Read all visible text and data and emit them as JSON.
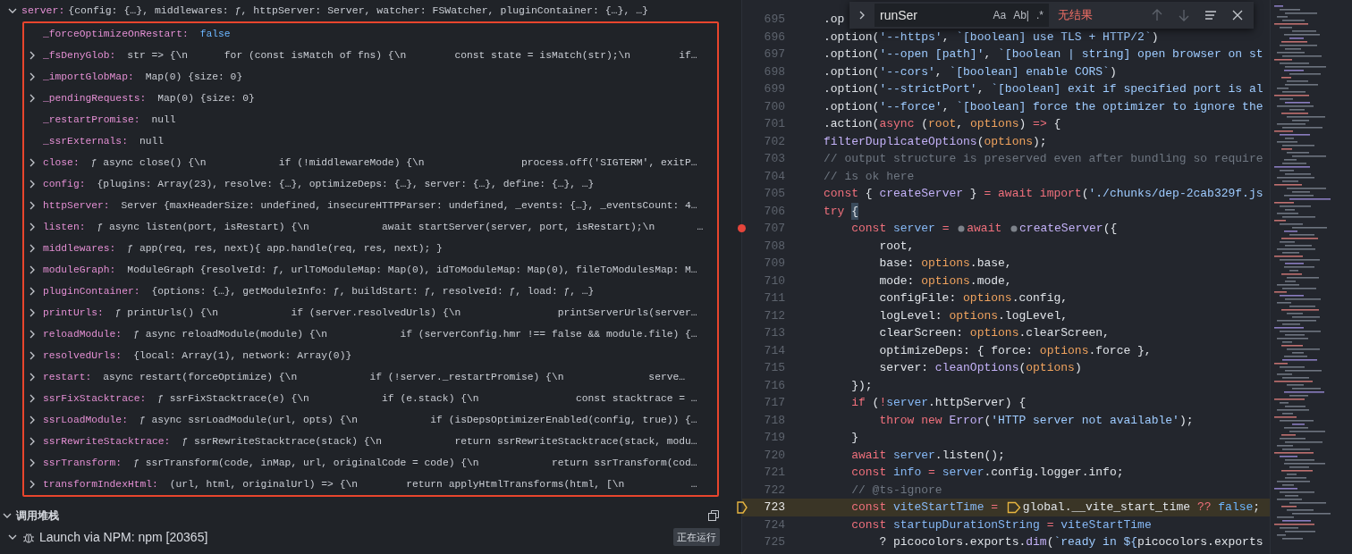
{
  "variables": {
    "header": {
      "expanded": true,
      "name": "server:",
      "value": "{config: {…}, middlewares: ƒ, httpServer: Server, watcher: FSWatcher, pluginContainer: {…}, …}"
    },
    "rows": [
      {
        "expandable": false,
        "name": "_forceOptimizeOnRestart:",
        "value": "false",
        "kind": "boolean"
      },
      {
        "expandable": true,
        "name": "_fsDenyGlob:",
        "value": "str => {\\n      for (const isMatch of fns) {\\n        const state = isMatch(str);\\n        if…",
        "kind": "plain"
      },
      {
        "expandable": true,
        "name": "_importGlobMap:",
        "value": "Map(0) {size: 0}",
        "kind": "plain"
      },
      {
        "expandable": true,
        "name": "_pendingRequests:",
        "value": "Map(0) {size: 0}",
        "kind": "plain"
      },
      {
        "expandable": false,
        "name": "_restartPromise:",
        "value": "null",
        "kind": "plain"
      },
      {
        "expandable": false,
        "name": "_ssrExternals:",
        "value": "null",
        "kind": "plain"
      },
      {
        "expandable": true,
        "name": "close:",
        "value": "ƒ async close() {\\n            if (!middlewareMode) {\\n                process.off('SIGTERM', exitP…",
        "kind": "plain"
      },
      {
        "expandable": true,
        "name": "config:",
        "value": "{plugins: Array(23), resolve: {…}, optimizeDeps: {…}, server: {…}, define: {…}, …}",
        "kind": "plain"
      },
      {
        "expandable": true,
        "name": "httpServer:",
        "value": "Server {maxHeaderSize: undefined, insecureHTTPParser: undefined, _events: {…}, _eventsCount: 4…",
        "kind": "plain"
      },
      {
        "expandable": true,
        "name": "listen:",
        "value": "ƒ async listen(port, isRestart) {\\n            await startServer(server, port, isRestart);\\n       …",
        "kind": "plain"
      },
      {
        "expandable": true,
        "name": "middlewares:",
        "value": "ƒ app(req, res, next){ app.handle(req, res, next); }",
        "kind": "plain"
      },
      {
        "expandable": true,
        "name": "moduleGraph:",
        "value": "ModuleGraph {resolveId: ƒ, urlToModuleMap: Map(0), idToModuleMap: Map(0), fileToModulesMap: M…",
        "kind": "plain"
      },
      {
        "expandable": true,
        "name": "pluginContainer:",
        "value": "{options: {…}, getModuleInfo: ƒ, buildStart: ƒ, resolveId: ƒ, load: ƒ, …}",
        "kind": "plain"
      },
      {
        "expandable": true,
        "name": "printUrls:",
        "value": "ƒ printUrls() {\\n            if (server.resolvedUrls) {\\n                printServerUrls(server…",
        "kind": "plain"
      },
      {
        "expandable": true,
        "name": "reloadModule:",
        "value": "ƒ async reloadModule(module) {\\n            if (serverConfig.hmr !== false && module.file) {…",
        "kind": "plain"
      },
      {
        "expandable": true,
        "name": "resolvedUrls:",
        "value": "{local: Array(1), network: Array(0)}",
        "kind": "plain"
      },
      {
        "expandable": true,
        "name": "restart:",
        "value": "async restart(forceOptimize) {\\n            if (!server._restartPromise) {\\n              serve…",
        "kind": "plain"
      },
      {
        "expandable": true,
        "name": "ssrFixStacktrace:",
        "value": "ƒ ssrFixStacktrace(e) {\\n            if (e.stack) {\\n                const stacktrace = …",
        "kind": "plain"
      },
      {
        "expandable": true,
        "name": "ssrLoadModule:",
        "value": "ƒ async ssrLoadModule(url, opts) {\\n            if (isDepsOptimizerEnabled(config, true)) {…",
        "kind": "plain"
      },
      {
        "expandable": true,
        "name": "ssrRewriteStacktrace:",
        "value": "ƒ ssrRewriteStacktrace(stack) {\\n            return ssrRewriteStacktrace(stack, modu…",
        "kind": "plain"
      },
      {
        "expandable": true,
        "name": "ssrTransform:",
        "value": "ƒ ssrTransform(code, inMap, url, originalCode = code) {\\n            return ssrTransform(cod…",
        "kind": "plain"
      },
      {
        "expandable": true,
        "name": "transformIndexHtml:",
        "value": "(url, html, originalUrl) => {\\n        return applyHtmlTransforms(html, [\\n           …",
        "kind": "plain"
      }
    ]
  },
  "call_stack": {
    "title": "调用堆栈",
    "expanded": true,
    "sessions": [
      {
        "expanded": true,
        "label": "Launch via NPM: npm [20365]",
        "status": "正在运行"
      }
    ]
  },
  "find_widget": {
    "value": "runSer",
    "toggles": [
      {
        "label": "Aa",
        "selected": false
      },
      {
        "label": "Ab|",
        "selected": false
      },
      {
        "label": ".*",
        "selected": false
      }
    ],
    "result": "无结果"
  },
  "editor": {
    "lines": [
      {
        "number": "695",
        "breakpoint": false,
        "current": false,
        "tokens": [
          {
            "kind": "plain",
            "text": ".op"
          }
        ]
      },
      {
        "number": "696",
        "breakpoint": false,
        "current": false,
        "tokens": [
          {
            "kind": "plain",
            "text": ".option("
          },
          {
            "kind": "string",
            "text": "'--https'"
          },
          {
            "kind": "plain",
            "text": ", "
          },
          {
            "kind": "string",
            "text": "`[boolean] use TLS + HTTP/2`"
          },
          {
            "kind": "plain",
            "text": ")"
          }
        ]
      },
      {
        "number": "697",
        "breakpoint": false,
        "current": false,
        "tokens": [
          {
            "kind": "plain",
            "text": ".option("
          },
          {
            "kind": "string",
            "text": "'--open [path]'"
          },
          {
            "kind": "plain",
            "text": ", "
          },
          {
            "kind": "string",
            "text": "`[boolean | string] open browser on st"
          }
        ]
      },
      {
        "number": "698",
        "breakpoint": false,
        "current": false,
        "tokens": [
          {
            "kind": "plain",
            "text": ".option("
          },
          {
            "kind": "string",
            "text": "'--cors'"
          },
          {
            "kind": "plain",
            "text": ", "
          },
          {
            "kind": "string",
            "text": "`[boolean] enable CORS`"
          },
          {
            "kind": "plain",
            "text": ")"
          }
        ]
      },
      {
        "number": "699",
        "breakpoint": false,
        "current": false,
        "tokens": [
          {
            "kind": "plain",
            "text": ".option("
          },
          {
            "kind": "string",
            "text": "'--strictPort'"
          },
          {
            "kind": "plain",
            "text": ", "
          },
          {
            "kind": "string",
            "text": "`[boolean] exit if specified port is al"
          }
        ]
      },
      {
        "number": "700",
        "breakpoint": false,
        "current": false,
        "tokens": [
          {
            "kind": "plain",
            "text": ".option("
          },
          {
            "kind": "string",
            "text": "'--force'"
          },
          {
            "kind": "plain",
            "text": ", "
          },
          {
            "kind": "string",
            "text": "`[boolean] force the optimizer to ignore the"
          }
        ]
      },
      {
        "number": "701",
        "breakpoint": false,
        "current": false,
        "tokens": [
          {
            "kind": "plain",
            "text": ".action("
          },
          {
            "kind": "keyword",
            "text": "async"
          },
          {
            "kind": "plain",
            "text": " ("
          },
          {
            "kind": "parameter",
            "text": "root"
          },
          {
            "kind": "plain",
            "text": ", "
          },
          {
            "kind": "parameter",
            "text": "options"
          },
          {
            "kind": "plain",
            "text": ") "
          },
          {
            "kind": "keyword",
            "text": "=>"
          },
          {
            "kind": "plain",
            "text": " {"
          }
        ]
      },
      {
        "number": "702",
        "breakpoint": false,
        "current": false,
        "tokens": [
          {
            "kind": "function",
            "text": "filterDuplicateOptions"
          },
          {
            "kind": "plain",
            "text": "("
          },
          {
            "kind": "parameter",
            "text": "options"
          },
          {
            "kind": "plain",
            "text": ");"
          }
        ]
      },
      {
        "number": "703",
        "breakpoint": false,
        "current": false,
        "tokens": [
          {
            "kind": "comment",
            "text": "// output structure is preserved even after bundling so require"
          }
        ]
      },
      {
        "number": "704",
        "breakpoint": false,
        "current": false,
        "tokens": [
          {
            "kind": "comment",
            "text": "// is ok here"
          }
        ]
      },
      {
        "number": "705",
        "breakpoint": false,
        "current": false,
        "tokens": [
          {
            "kind": "keyword",
            "text": "const"
          },
          {
            "kind": "plain",
            "text": " { "
          },
          {
            "kind": "function",
            "text": "createServer"
          },
          {
            "kind": "plain",
            "text": " } "
          },
          {
            "kind": "keyword",
            "text": "= await import"
          },
          {
            "kind": "plain",
            "text": "("
          },
          {
            "kind": "string",
            "text": "'./chunks/dep-2cab329f.js"
          }
        ]
      },
      {
        "number": "706",
        "breakpoint": false,
        "current": false,
        "tokens": [
          {
            "kind": "keyword",
            "text": "try "
          },
          {
            "kind": "bracket",
            "text": "{"
          }
        ]
      },
      {
        "number": "707",
        "breakpoint": true,
        "current": false,
        "tokens": [
          {
            "kind": "keyword",
            "text": "    const "
          },
          {
            "kind": "variable",
            "text": "server "
          },
          {
            "kind": "keyword",
            "text": "= "
          },
          {
            "kind": "hint"
          },
          {
            "kind": "keyword",
            "text": "await "
          },
          {
            "kind": "hint"
          },
          {
            "kind": "function",
            "text": "createServer"
          },
          {
            "kind": "plain",
            "text": "({"
          }
        ]
      },
      {
        "number": "708",
        "breakpoint": false,
        "current": false,
        "tokens": [
          {
            "kind": "plain",
            "text": "        root,"
          }
        ]
      },
      {
        "number": "709",
        "breakpoint": false,
        "current": false,
        "tokens": [
          {
            "kind": "plain",
            "text": "        base: "
          },
          {
            "kind": "parameter",
            "text": "options"
          },
          {
            "kind": "plain",
            "text": ".base,"
          }
        ]
      },
      {
        "number": "710",
        "breakpoint": false,
        "current": false,
        "tokens": [
          {
            "kind": "plain",
            "text": "        mode: "
          },
          {
            "kind": "parameter",
            "text": "options"
          },
          {
            "kind": "plain",
            "text": ".mode,"
          }
        ]
      },
      {
        "number": "711",
        "breakpoint": false,
        "current": false,
        "tokens": [
          {
            "kind": "plain",
            "text": "        configFile: "
          },
          {
            "kind": "parameter",
            "text": "options"
          },
          {
            "kind": "plain",
            "text": ".config,"
          }
        ]
      },
      {
        "number": "712",
        "breakpoint": false,
        "current": false,
        "tokens": [
          {
            "kind": "plain",
            "text": "        logLevel: "
          },
          {
            "kind": "parameter",
            "text": "options"
          },
          {
            "kind": "plain",
            "text": ".logLevel,"
          }
        ]
      },
      {
        "number": "713",
        "breakpoint": false,
        "current": false,
        "tokens": [
          {
            "kind": "plain",
            "text": "        clearScreen: "
          },
          {
            "kind": "parameter",
            "text": "options"
          },
          {
            "kind": "plain",
            "text": ".clearScreen,"
          }
        ]
      },
      {
        "number": "714",
        "breakpoint": false,
        "current": false,
        "tokens": [
          {
            "kind": "plain",
            "text": "        optimizeDeps: { force: "
          },
          {
            "kind": "parameter",
            "text": "options"
          },
          {
            "kind": "plain",
            "text": ".force },"
          }
        ]
      },
      {
        "number": "715",
        "breakpoint": false,
        "current": false,
        "tokens": [
          {
            "kind": "plain",
            "text": "        server: "
          },
          {
            "kind": "function",
            "text": "cleanOptions"
          },
          {
            "kind": "plain",
            "text": "("
          },
          {
            "kind": "parameter",
            "text": "options"
          },
          {
            "kind": "plain",
            "text": ")"
          }
        ]
      },
      {
        "number": "716",
        "breakpoint": false,
        "current": false,
        "tokens": [
          {
            "kind": "plain",
            "text": "    });"
          }
        ]
      },
      {
        "number": "717",
        "breakpoint": false,
        "current": false,
        "tokens": [
          {
            "kind": "keyword",
            "text": "    if "
          },
          {
            "kind": "plain",
            "text": "("
          },
          {
            "kind": "keyword",
            "text": "!"
          },
          {
            "kind": "variable",
            "text": "server"
          },
          {
            "kind": "plain",
            "text": ".httpServer) {"
          }
        ]
      },
      {
        "number": "718",
        "breakpoint": false,
        "current": false,
        "tokens": [
          {
            "kind": "keyword",
            "text": "        throw new "
          },
          {
            "kind": "function",
            "text": "Error"
          },
          {
            "kind": "plain",
            "text": "("
          },
          {
            "kind": "string",
            "text": "'HTTP server not available'"
          },
          {
            "kind": "plain",
            "text": ");"
          }
        ]
      },
      {
        "number": "719",
        "breakpoint": false,
        "current": false,
        "tokens": [
          {
            "kind": "plain",
            "text": "    }"
          }
        ]
      },
      {
        "number": "720",
        "breakpoint": false,
        "current": false,
        "tokens": [
          {
            "kind": "keyword",
            "text": "    await "
          },
          {
            "kind": "variable",
            "text": "server"
          },
          {
            "kind": "plain",
            "text": ".listen();"
          }
        ]
      },
      {
        "number": "721",
        "breakpoint": false,
        "current": false,
        "tokens": [
          {
            "kind": "keyword",
            "text": "    const "
          },
          {
            "kind": "variable",
            "text": "info "
          },
          {
            "kind": "keyword",
            "text": "= "
          },
          {
            "kind": "variable",
            "text": "server"
          },
          {
            "kind": "plain",
            "text": ".config.logger.info;"
          }
        ]
      },
      {
        "number": "722",
        "breakpoint": false,
        "current": false,
        "tokens": [
          {
            "kind": "comment",
            "text": "    // @ts-ignore"
          }
        ]
      },
      {
        "number": "723",
        "breakpoint": false,
        "current": true,
        "tokens": [
          {
            "kind": "keyword",
            "text": "    const "
          },
          {
            "kind": "variable",
            "text": "viteStartTime "
          },
          {
            "kind": "keyword",
            "text": "= "
          },
          {
            "kind": "stop"
          },
          {
            "kind": "plain",
            "text": "global.__vite_start_time "
          },
          {
            "kind": "keyword",
            "text": "?? "
          },
          {
            "kind": "literal",
            "text": "false"
          },
          {
            "kind": "plain",
            "text": ";"
          }
        ]
      },
      {
        "number": "724",
        "breakpoint": false,
        "current": false,
        "tokens": [
          {
            "kind": "keyword",
            "text": "    const "
          },
          {
            "kind": "variable",
            "text": "startupDurationString "
          },
          {
            "kind": "keyword",
            "text": "= "
          },
          {
            "kind": "variable",
            "text": "viteStartTime"
          }
        ]
      },
      {
        "number": "725",
        "breakpoint": false,
        "current": false,
        "tokens": [
          {
            "kind": "plain",
            "text": "        ? picocolors.exports."
          },
          {
            "kind": "function",
            "text": "dim"
          },
          {
            "kind": "plain",
            "text": "("
          },
          {
            "kind": "string",
            "text": "`ready in ${"
          },
          {
            "kind": "plain",
            "text": "picocolors.exports"
          }
        ]
      }
    ]
  }
}
